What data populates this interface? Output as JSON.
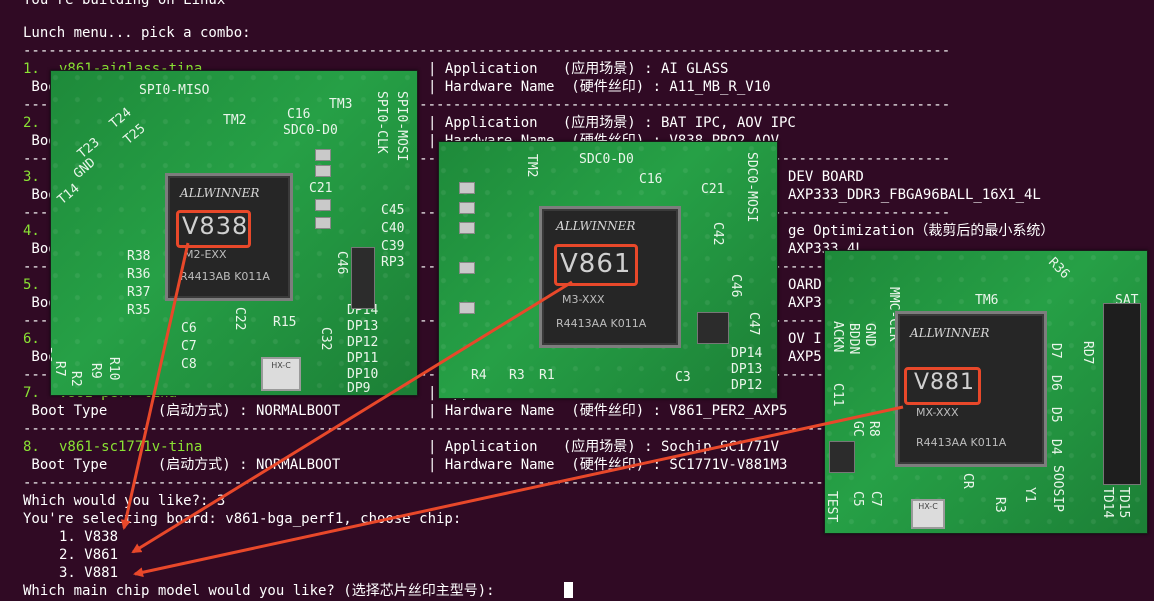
{
  "terminal": {
    "line_top": "You're building on Linux",
    "lunch_prompt": "Lunch menu... pick a combo:",
    "separator": "--------------------------------------------------------------------------------------------------------------",
    "options": [
      {
        "num": "1.",
        "name": "v861-aiglass-tina",
        "left2": " Boo",
        "app": "| Application   (应用场景) : AI GLASS",
        "hw": "| Hardware Name  (硬件丝印) : A11_MB_R_V10"
      },
      {
        "num": "2.",
        "name": "",
        "left2": " Boo",
        "app": "| Application   (应用场景) : BAT IPC, AOV IPC",
        "hw": "| Hardware Name  (硬件丝印) : V838_PRO2_AOV"
      },
      {
        "num": "3.",
        "name": "",
        "left2": " Boo",
        "app": "DEV BOARD",
        "hw": "AXP333_DDR3_FBGA96BALL_16X1_4L"
      },
      {
        "num": "4.",
        "name": "",
        "left2": " Boo",
        "app": "ge Optimization（裁剪后的最小系统）",
        "hw": "AXP333_4L"
      },
      {
        "num": "5.",
        "name": "",
        "left2": " Boo",
        "app": "OARD",
        "hw": "AXP3"
      },
      {
        "num": "6.",
        "name": "",
        "left2": " Boo",
        "app": "OV I",
        "hw": "AXP5"
      },
      {
        "num": "7.",
        "name": "v861-perf-tina",
        "left2": " Boot Type      (启动方式) : NORMALBOOT",
        "app": "| Application   (应用场景) : BAT IPC, AOV I",
        "hw": "| Hardware Name  (硬件丝印) : V861_PER2_AXP5"
      },
      {
        "num": "8.",
        "name": "v861-sc1771v-tina",
        "left2": " Boot Type      (启动方式) : NORMALBOOT",
        "app": "| Application   (应用场景) : Sochip SC1771V",
        "hw": "| Hardware Name  (硬件丝印) : SC1771V-V881M3"
      }
    ],
    "which_prompt": "Which would you like?: 3",
    "selecting": "You're selecting board: v861-bga_perf1, choose chip:",
    "chips": [
      "1. V838",
      "2. V861",
      "3. V881"
    ],
    "final_prompt": "Which main chip model would you like? (选择芯片丝印主型号): "
  },
  "photos": [
    {
      "silk": [
        "SPI0-MISO",
        "TM3",
        "SPI0-CLK",
        "SPI0-MOSI",
        "TM2",
        "C16",
        "SDC0-D0",
        "T24",
        "T25",
        "T23",
        "GND",
        "T14",
        "C21",
        "C45",
        "C40",
        "C39",
        "RP3",
        "R38",
        "R36",
        "R37",
        "R35",
        "C6",
        "C7",
        "C8",
        "C46",
        "C22",
        "R15",
        "C32",
        "DP14",
        "DP13",
        "DP12",
        "DP11",
        "DP10",
        "DP9",
        "R10",
        "R9",
        "R2",
        "R7",
        "R6"
      ],
      "logo": "ALLWINNER",
      "model": "V838",
      "sub1": "M2-EXX",
      "sub2": "R4413AB   K011A",
      "crystal": "HX-C"
    },
    {
      "silk": [
        "SDC0-D0",
        "SDC0-MOSI",
        "TM2",
        "C16",
        "C21",
        "C42",
        "C46",
        "C47",
        "DP14",
        "DP13",
        "DP12",
        "C3",
        "R4",
        "R3",
        "R1"
      ],
      "logo": "ALLWINNER",
      "model": "V861",
      "sub1": "M3-XXX",
      "sub2": "R4413AA   K011A"
    },
    {
      "silk": [
        "MMC-CLK",
        "TM6",
        "R36",
        "SAT",
        "ACKN",
        "BDDN",
        "GND",
        "C11",
        "D7",
        "D6",
        "D5",
        "D4",
        "RD7",
        "R8",
        "GC",
        "TEST",
        "C5",
        "C7",
        "R3",
        "Y1",
        "SOOSIP",
        "CR",
        "TD14",
        "TD15"
      ],
      "logo": "ALLWINNER",
      "model": "V881",
      "sub1": "MX-XXX",
      "sub2": "R4413AA   K011A",
      "crystal": "HX-C"
    }
  ],
  "colors": {
    "terminal_bg": "#300a24",
    "text": "#ffffff",
    "option_name": "#8ae234",
    "highlight": "#e8482a"
  }
}
